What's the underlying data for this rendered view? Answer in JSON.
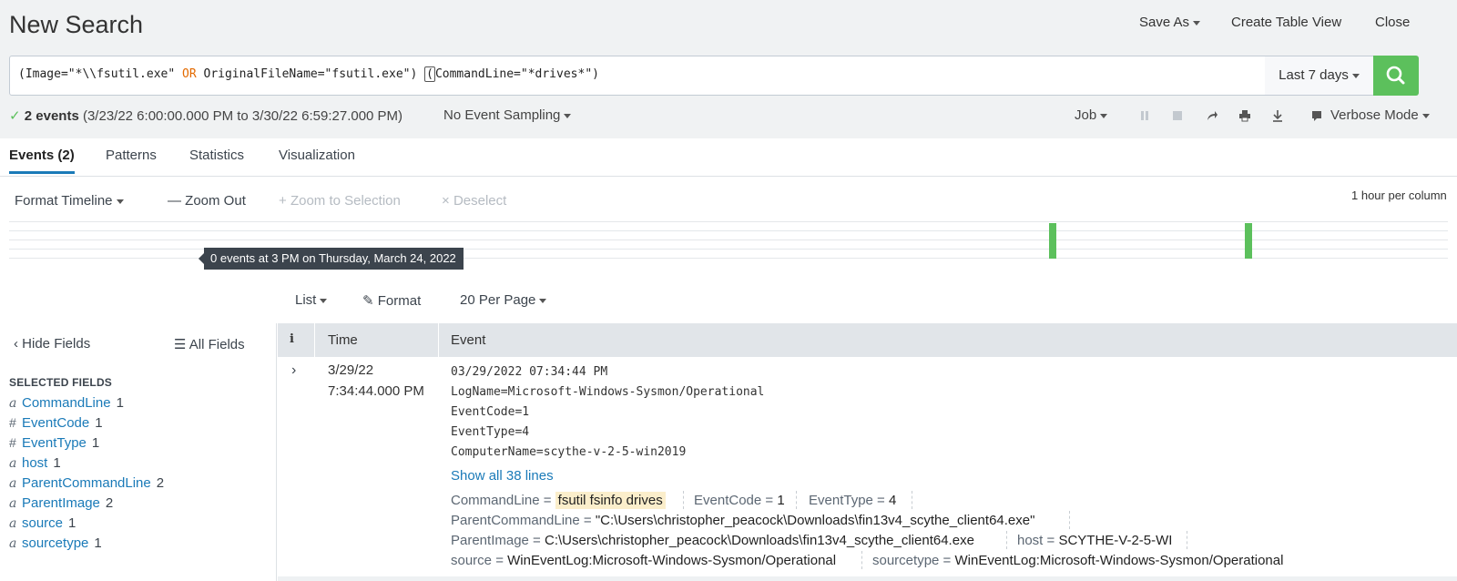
{
  "header": {
    "title": "New Search",
    "save_as": "Save As",
    "create_table_view": "Create Table View",
    "close": "Close"
  },
  "search": {
    "query_part1": "(Image=\"*\\\\fsutil.exe\" ",
    "query_or": "OR",
    "query_part2": " OriginalFileName=\"fsutil.exe\") ",
    "query_cursor": "(",
    "query_part3": "CommandLine=\"*drives*\")",
    "time_range": "Last 7 days"
  },
  "status": {
    "check": "✓",
    "count": "2 events",
    "range": "(3/23/22 6:00:00.000 PM to 3/30/22 6:59:27.000 PM)",
    "sampling": "No Event Sampling",
    "job": "Job",
    "mode": "Verbose Mode"
  },
  "tabs": [
    {
      "label": "Events (2)"
    },
    {
      "label": "Patterns"
    },
    {
      "label": "Statistics"
    },
    {
      "label": "Visualization"
    }
  ],
  "timeline": {
    "format": "Format Timeline",
    "zoom_out": "Zoom Out",
    "zoom_sel": "Zoom to Selection",
    "deselect": "Deselect",
    "per_column": "1 hour per column",
    "tooltip": "0 events at 3 PM on Thursday, March 24, 2022"
  },
  "list_controls": {
    "list": "List",
    "format": "Format",
    "per_page": "20 Per Page"
  },
  "fields": {
    "hide": "Hide Fields",
    "all": "All Fields",
    "selected_header": "SELECTED FIELDS",
    "items": [
      {
        "type": "a",
        "name": "CommandLine",
        "count": "1"
      },
      {
        "type": "#",
        "name": "EventCode",
        "count": "1"
      },
      {
        "type": "#",
        "name": "EventType",
        "count": "1"
      },
      {
        "type": "a",
        "name": "host",
        "count": "1"
      },
      {
        "type": "a",
        "name": "ParentCommandLine",
        "count": "2"
      },
      {
        "type": "a",
        "name": "ParentImage",
        "count": "2"
      },
      {
        "type": "a",
        "name": "source",
        "count": "1"
      },
      {
        "type": "a",
        "name": "sourcetype",
        "count": "1"
      }
    ]
  },
  "table": {
    "col_i": "i",
    "col_time": "Time",
    "col_event": "Event"
  },
  "event": {
    "date": "3/29/22",
    "time": "7:34:44.000 PM",
    "raw": [
      "03/29/2022 07:34:44 PM",
      "LogName=Microsoft-Windows-Sysmon/Operational",
      "EventCode=1",
      "EventType=4",
      "ComputerName=scythe-v-2-5-win2019"
    ],
    "show_all": "Show all 38 lines",
    "kv": {
      "commandline_k": "CommandLine =",
      "commandline_v": "fsutil fsinfo drives",
      "eventcode_k": "EventCode =",
      "eventcode_v": "1",
      "eventtype_k": "EventType =",
      "eventtype_v": "4",
      "pcl_k": "ParentCommandLine =",
      "pcl_v": "\"C:\\Users\\christopher_peacock\\Downloads\\fin13v4_scythe_client64.exe\"",
      "pimg_k": "ParentImage =",
      "pimg_v": "C:\\Users\\christopher_peacock\\Downloads\\fin13v4_scythe_client64.exe",
      "host_k": "host =",
      "host_v": "SCYTHE-V-2-5-WI",
      "source_k": "source =",
      "source_v": "WinEventLog:Microsoft-Windows-Sysmon/Operational",
      "sourcetype_k": "sourcetype =",
      "sourcetype_v": "WinEventLog:Microsoft-Windows-Sysmon/Operational"
    }
  },
  "colors": {
    "accent": "#1a7ab8",
    "green": "#5cc05c",
    "highlight": "#fbeecb"
  }
}
